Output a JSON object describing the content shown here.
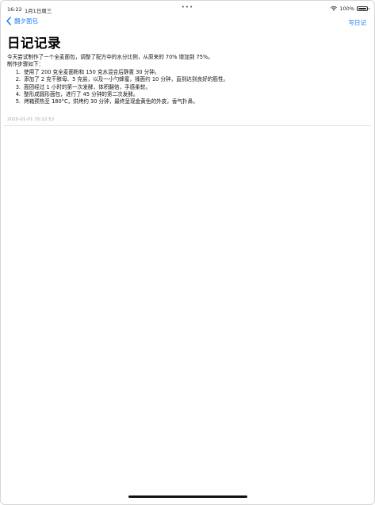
{
  "status_bar": {
    "time": "16:22",
    "date": "1月1日周三",
    "battery_text": "100%",
    "battery_level": 1.0
  },
  "nav": {
    "back_label": "翻夕面包",
    "action_label": "写日记"
  },
  "page_title": "日记记录",
  "entry": {
    "intro": "今天尝试制作了一个全麦面包，调整了配方中的水分比例，从原来的 70% 增加到 75%。",
    "steps_heading": "制作步骤如下：",
    "steps": [
      {
        "num": "1.",
        "text": "使用了 200 克全麦面粉和 150 克水混合后静置 30 分钟。"
      },
      {
        "num": "2.",
        "text": "添加了 2 克干酵母、5 克盐，以及一小勺蜂蜜，揉面约 10 分钟，直到达到良好的筋性。"
      },
      {
        "num": "3.",
        "text": "面团经过 1 小时的第一次发酵，体积翻倍，手感柔软。"
      },
      {
        "num": "4.",
        "text": "整形成圆形面包，进行了 45 分钟的第二次发酵。"
      },
      {
        "num": "5.",
        "text": "烤箱预热至 180°C，烘烤约 30 分钟，最终呈现金黄色的外皮，香气扑鼻。"
      }
    ],
    "timestamp": "2020-01-01 15:22:52"
  },
  "colors": {
    "accent": "#1a7cf5",
    "timestamp": "#a6a6a6"
  }
}
